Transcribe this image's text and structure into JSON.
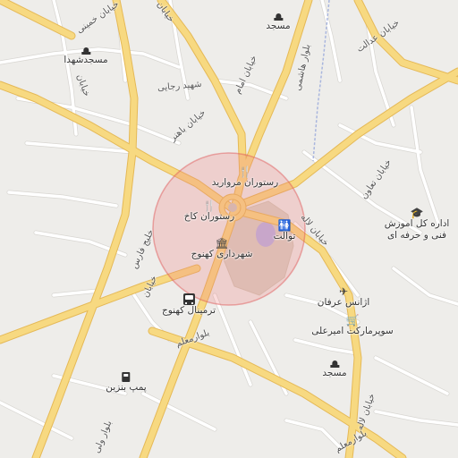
{
  "map": {
    "colors": {
      "background": "#eeedea",
      "major_road": "#f7d981",
      "major_road_casing": "#e5b957",
      "minor_road": "#ffffff",
      "minor_road_casing": "#d8d6d2",
      "park": "#d8d3c6",
      "water": "#b9b4e6",
      "river": "#a9b6de",
      "radius_fill": "#f08080",
      "radius_stroke": "#e05b5b"
    },
    "pois": [
      {
        "name": "mosque-top",
        "icon": "mosque-icon",
        "label": "مسجد"
      },
      {
        "name": "masjed-shohada",
        "icon": "mosque-icon",
        "label": "مسجدشهدا"
      },
      {
        "name": "restaurant-morvarid",
        "icon": "restaurant-icon",
        "label": "رستوران مروارید"
      },
      {
        "name": "restaurant-kakh",
        "icon": "restaurant-icon",
        "label": "رستوران کاخ"
      },
      {
        "name": "toilet",
        "icon": "toilet-icon",
        "label": "توالت"
      },
      {
        "name": "shahrdari-kahnooj",
        "icon": "townhall-icon",
        "label": "شهرداری کهنوج"
      },
      {
        "name": "terminal-kahnooj",
        "icon": "bus-icon",
        "label": "ترمینال کهنوج"
      },
      {
        "name": "adareh-fanni",
        "icon": "school-icon",
        "label": "اداره کل اموزش\nفنی و حرفه ای"
      },
      {
        "name": "agency-erfan",
        "icon": "flight-icon",
        "label": "اژانس عرفان"
      },
      {
        "name": "supermarket-amirali",
        "icon": "cart-icon",
        "label": "سوپرمارکت امیرعلی"
      },
      {
        "name": "mosque-bottom",
        "icon": "mosque-icon",
        "label": "مسجد"
      },
      {
        "name": "pomp-benzin",
        "icon": "fuel-icon",
        "label": "پمپ بنزین"
      }
    ],
    "streets": [
      {
        "name": "street-khomeini",
        "label": "خیابان خمینی"
      },
      {
        "name": "street-top",
        "label": "خیابان"
      },
      {
        "name": "street-emam",
        "label": "خیابان امام"
      },
      {
        "name": "street-hashemi",
        "label": "بلوار هاشمی"
      },
      {
        "name": "street-edalat",
        "label": "خیابان عدالت"
      },
      {
        "name": "street-jahan",
        "label": "خیابان"
      },
      {
        "name": "street-shahid-rajaei",
        "label": "شهید رجایی"
      },
      {
        "name": "street-bahonar",
        "label": "خیابان باهنر"
      },
      {
        "name": "street-taavon",
        "label": "خیابان تعاون"
      },
      {
        "name": "street-lale",
        "label": "خیابان لاله"
      },
      {
        "name": "street-khalij-fars",
        "label": "خلیج فارس"
      },
      {
        "name": "street-khalij-prefix",
        "label": "خیابان"
      },
      {
        "name": "street-moallem",
        "label": "بلوارمعلم"
      },
      {
        "name": "street-lale-south",
        "label": "خیابان لاله"
      },
      {
        "name": "street-moallem-south",
        "label": "بلوارمعلم"
      },
      {
        "name": "street-valiasr",
        "label": "بلوار ولی"
      }
    ]
  }
}
